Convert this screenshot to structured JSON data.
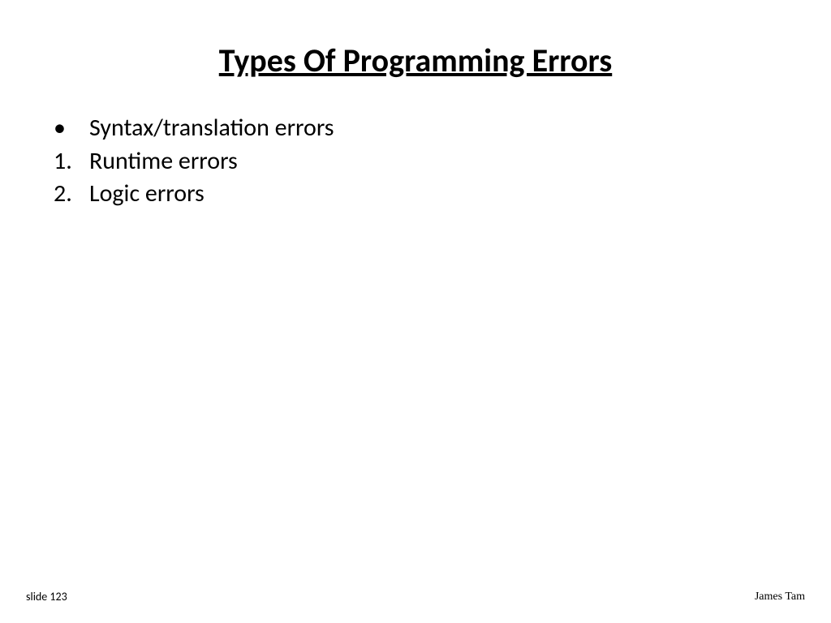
{
  "title": "Types Of Programming Errors",
  "items": [
    {
      "marker": "•",
      "text": "Syntax/translation errors"
    },
    {
      "marker": "1.",
      "text": "Runtime errors"
    },
    {
      "marker": "2.",
      "text": "Logic errors"
    }
  ],
  "footer": {
    "left": "slide 123",
    "right": "James Tam"
  }
}
